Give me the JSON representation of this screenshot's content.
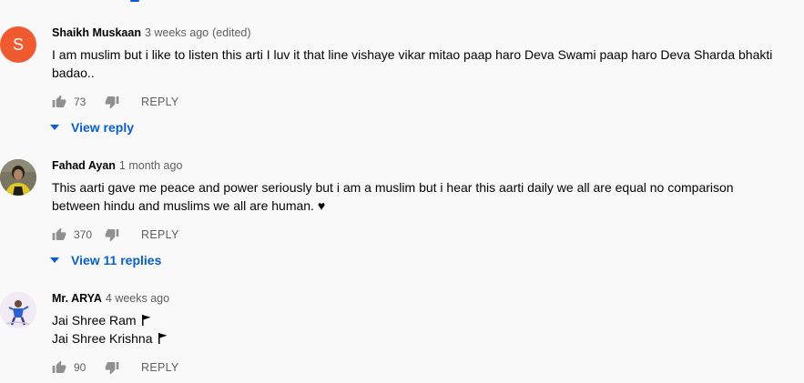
{
  "comments": [
    {
      "author": "Shaikh Muskaan",
      "time": "3 weeks ago",
      "edited": "(edited)",
      "avatar_letter": "S",
      "text_lines": [
        "I am muslim but i like to listen this arti I luv it that line vishaye vikar mitao paap haro Deva Swami paap haro Deva Sharda bhakti",
        "badao.."
      ],
      "likes": "73",
      "reply_label": "REPLY",
      "view_replies": "View reply"
    },
    {
      "author": "Fahad Ayan",
      "time": "1 month ago",
      "text_lines": [
        "This aarti gave me peace and power seriously but i am a muslim but i hear this aarti daily we all are equal no comparison",
        "between hindu and muslims we all are human. ♥"
      ],
      "likes": "370",
      "reply_label": "REPLY",
      "view_replies": "View 11 replies"
    },
    {
      "author": "Mr. ARYA",
      "time": "4 weeks ago",
      "text_lines": [
        "Jai Shree Ram",
        "Jai Shree Krishna"
      ],
      "likes": "90",
      "reply_label": "REPLY"
    }
  ],
  "icons": {
    "like": "thumbs-up-icon",
    "dislike": "thumbs-down-icon",
    "caret": "caret-down-icon",
    "flag": "flag-icon"
  },
  "colors": {
    "link_blue": "#065fd4",
    "avatar_s": "#ef5a2f",
    "meta_gray": "#606060"
  }
}
